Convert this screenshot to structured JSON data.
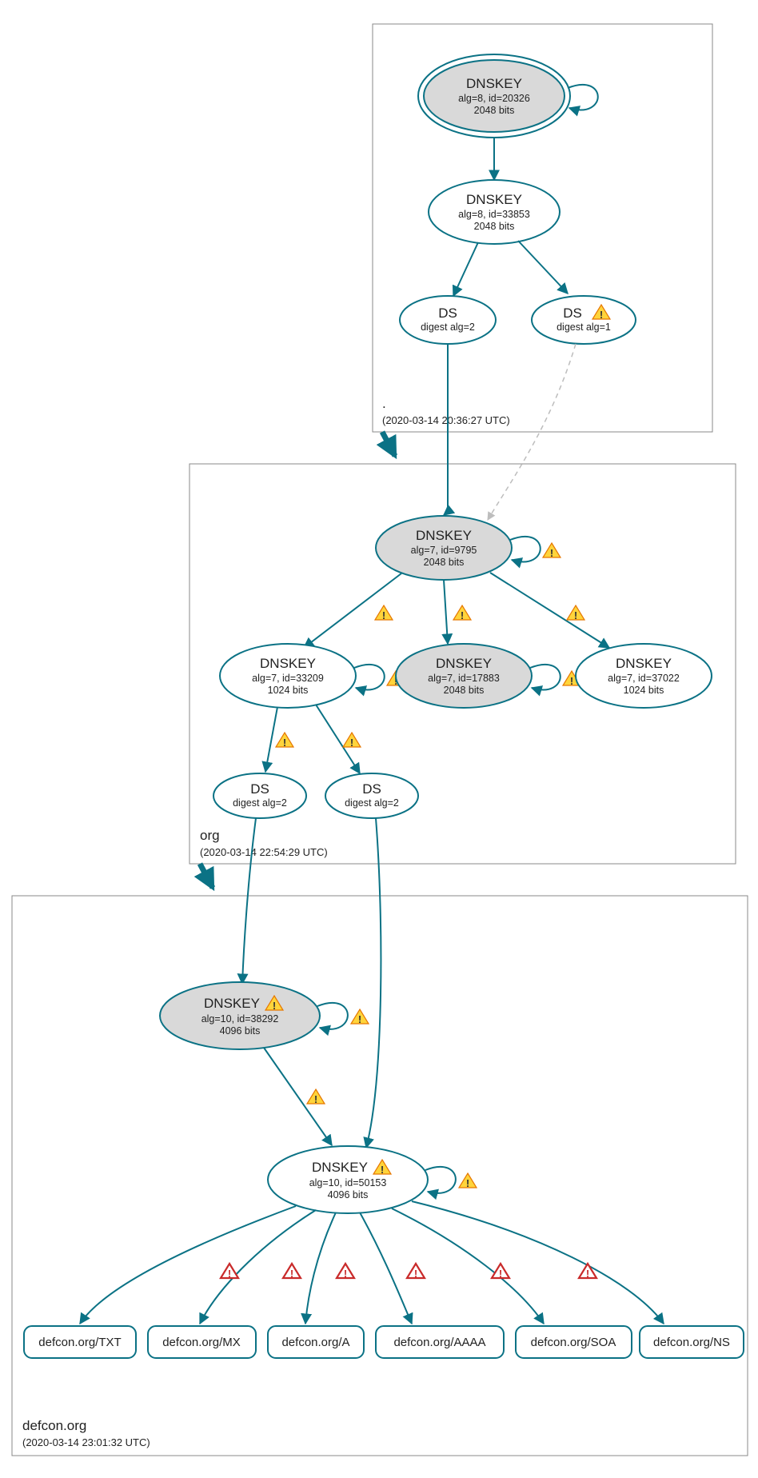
{
  "chart_data": {
    "type": "dnssec-chain",
    "zones": [
      {
        "name": ".",
        "timestamp": "(2020-03-14 20:36:27 UTC)",
        "nodes": [
          {
            "id": "root-ksk",
            "type": "DNSKEY",
            "title": "DNSKEY",
            "detail1": "alg=8, id=20326",
            "detail2": "2048 bits",
            "ksk": true,
            "warn": null,
            "self_loop": true,
            "loop_warn": null
          },
          {
            "id": "root-zsk",
            "type": "DNSKEY",
            "title": "DNSKEY",
            "detail1": "alg=8, id=33853",
            "detail2": "2048 bits",
            "ksk": false,
            "warn": null,
            "self_loop": false
          },
          {
            "id": "root-ds2",
            "type": "DS",
            "title": "DS",
            "detail1": "digest alg=2",
            "warn": null
          },
          {
            "id": "root-ds1",
            "type": "DS",
            "title": "DS",
            "detail1": "digest alg=1",
            "warn": "yellow"
          }
        ],
        "edges": [
          {
            "from": "root-ksk",
            "to": "root-zsk",
            "warn": null
          },
          {
            "from": "root-zsk",
            "to": "root-ds2",
            "warn": null
          },
          {
            "from": "root-zsk",
            "to": "root-ds1",
            "warn": null
          }
        ]
      },
      {
        "name": "org",
        "timestamp": "(2020-03-14 22:54:29 UTC)",
        "nodes": [
          {
            "id": "org-ksk",
            "type": "DNSKEY",
            "title": "DNSKEY",
            "detail1": "alg=7, id=9795",
            "detail2": "2048 bits",
            "ksk": true,
            "warn": null,
            "self_loop": true,
            "loop_warn": "yellow"
          },
          {
            "id": "org-z1",
            "type": "DNSKEY",
            "title": "DNSKEY",
            "detail1": "alg=7, id=33209",
            "detail2": "1024 bits",
            "ksk": false,
            "self_loop": true,
            "loop_warn": "yellow"
          },
          {
            "id": "org-z2",
            "type": "DNSKEY",
            "title": "DNSKEY",
            "detail1": "alg=7, id=17883",
            "detail2": "2048 bits",
            "ksk": true,
            "self_loop": true,
            "loop_warn": "yellow"
          },
          {
            "id": "org-z3",
            "type": "DNSKEY",
            "title": "DNSKEY",
            "detail1": "alg=7, id=37022",
            "detail2": "1024 bits",
            "ksk": false,
            "self_loop": false
          },
          {
            "id": "org-ds1",
            "type": "DS",
            "title": "DS",
            "detail1": "digest alg=2"
          },
          {
            "id": "org-ds2",
            "type": "DS",
            "title": "DS",
            "detail1": "digest alg=2"
          }
        ],
        "edges": [
          {
            "from": "root-ds2",
            "to": "org-ksk",
            "style": "solid"
          },
          {
            "from": "root-ds1",
            "to": "org-ksk",
            "style": "dashed"
          },
          {
            "from": "org-ksk",
            "to": "org-z1",
            "warn": "yellow"
          },
          {
            "from": "org-ksk",
            "to": "org-z2",
            "warn": "yellow"
          },
          {
            "from": "org-ksk",
            "to": "org-z3",
            "warn": "yellow"
          },
          {
            "from": "org-z1",
            "to": "org-ds1",
            "warn": "yellow"
          },
          {
            "from": "org-z1",
            "to": "org-ds2",
            "warn": "yellow"
          }
        ]
      },
      {
        "name": "defcon.org",
        "timestamp": "(2020-03-14 23:01:32 UTC)",
        "nodes": [
          {
            "id": "dc-ksk",
            "type": "DNSKEY",
            "title": "DNSKEY",
            "detail1": "alg=10, id=38292",
            "detail2": "4096 bits",
            "ksk": true,
            "warn": "yellow",
            "self_loop": true,
            "loop_warn": "yellow"
          },
          {
            "id": "dc-zsk",
            "type": "DNSKEY",
            "title": "DNSKEY",
            "detail1": "alg=10, id=50153",
            "detail2": "4096 bits",
            "ksk": false,
            "warn": "yellow",
            "self_loop": true,
            "loop_warn": "yellow"
          },
          {
            "id": "rr-txt",
            "type": "RR",
            "title": "defcon.org/TXT"
          },
          {
            "id": "rr-mx",
            "type": "RR",
            "title": "defcon.org/MX"
          },
          {
            "id": "rr-a",
            "type": "RR",
            "title": "defcon.org/A"
          },
          {
            "id": "rr-aaaa",
            "type": "RR",
            "title": "defcon.org/AAAA"
          },
          {
            "id": "rr-soa",
            "type": "RR",
            "title": "defcon.org/SOA"
          },
          {
            "id": "rr-ns",
            "type": "RR",
            "title": "defcon.org/NS"
          }
        ],
        "edges": [
          {
            "from": "org-ds1",
            "to": "dc-ksk"
          },
          {
            "from": "org-ds2",
            "to": "dc-zsk"
          },
          {
            "from": "dc-ksk",
            "to": "dc-zsk",
            "warn": "yellow"
          },
          {
            "from": "dc-zsk",
            "to": "rr-txt",
            "warn": "red"
          },
          {
            "from": "dc-zsk",
            "to": "rr-mx",
            "warn": "red"
          },
          {
            "from": "dc-zsk",
            "to": "rr-a",
            "warn": "red"
          },
          {
            "from": "dc-zsk",
            "to": "rr-aaaa",
            "warn": "red"
          },
          {
            "from": "dc-zsk",
            "to": "rr-soa",
            "warn": "red"
          },
          {
            "from": "dc-zsk",
            "to": "rr-ns",
            "warn": "red"
          }
        ]
      }
    ]
  },
  "zones": {
    "root": {
      "name": ".",
      "ts": "(2020-03-14 20:36:27 UTC)"
    },
    "org": {
      "name": "org",
      "ts": "(2020-03-14 22:54:29 UTC)"
    },
    "dc": {
      "name": "defcon.org",
      "ts": "(2020-03-14 23:01:32 UTC)"
    }
  },
  "n": {
    "root_ksk": {
      "t": "DNSKEY",
      "d1": "alg=8, id=20326",
      "d2": "2048 bits"
    },
    "root_zsk": {
      "t": "DNSKEY",
      "d1": "alg=8, id=33853",
      "d2": "2048 bits"
    },
    "root_ds2": {
      "t": "DS",
      "d1": "digest alg=2"
    },
    "root_ds1": {
      "t": "DS",
      "d1": "digest alg=1"
    },
    "org_ksk": {
      "t": "DNSKEY",
      "d1": "alg=7, id=9795",
      "d2": "2048 bits"
    },
    "org_z1": {
      "t": "DNSKEY",
      "d1": "alg=7, id=33209",
      "d2": "1024 bits"
    },
    "org_z2": {
      "t": "DNSKEY",
      "d1": "alg=7, id=17883",
      "d2": "2048 bits"
    },
    "org_z3": {
      "t": "DNSKEY",
      "d1": "alg=7, id=37022",
      "d2": "1024 bits"
    },
    "org_ds1": {
      "t": "DS",
      "d1": "digest alg=2"
    },
    "org_ds2": {
      "t": "DS",
      "d1": "digest alg=2"
    },
    "dc_ksk": {
      "t": "DNSKEY",
      "d1": "alg=10, id=38292",
      "d2": "4096 bits"
    },
    "dc_zsk": {
      "t": "DNSKEY",
      "d1": "alg=10, id=50153",
      "d2": "4096 bits"
    },
    "rr_txt": {
      "t": "defcon.org/TXT"
    },
    "rr_mx": {
      "t": "defcon.org/MX"
    },
    "rr_a": {
      "t": "defcon.org/A"
    },
    "rr_aaaa": {
      "t": "defcon.org/AAAA"
    },
    "rr_soa": {
      "t": "defcon.org/SOA"
    },
    "rr_ns": {
      "t": "defcon.org/NS"
    }
  }
}
